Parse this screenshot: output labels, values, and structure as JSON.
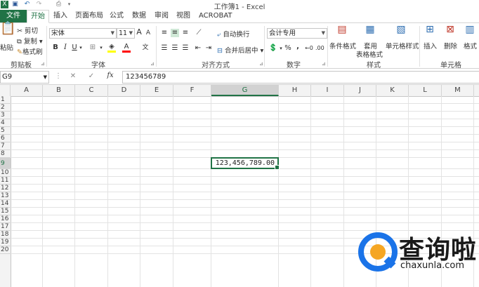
{
  "window": {
    "title": "工作簿1 - Excel"
  },
  "quick_access": {
    "icons": [
      "excel-logo-icon",
      "save-icon",
      "undo-icon",
      "redo-icon",
      "preview-icon",
      "customize-icon"
    ]
  },
  "tabs": [
    {
      "label": "文件"
    },
    {
      "label": "开始"
    },
    {
      "label": "插入"
    },
    {
      "label": "页面布局"
    },
    {
      "label": "公式"
    },
    {
      "label": "数据"
    },
    {
      "label": "审阅"
    },
    {
      "label": "视图"
    },
    {
      "label": "ACROBAT"
    }
  ],
  "ribbon": {
    "clipboard": {
      "paste": "粘贴",
      "cut": "剪切",
      "copy": "复制",
      "format_painter": "格式刷",
      "group": "剪贴板"
    },
    "font": {
      "name": "宋体",
      "size": "11",
      "grow": "A",
      "shrink": "A",
      "bold": "B",
      "italic": "I",
      "underline": "U",
      "color_a": "A",
      "phonetic": "文",
      "group": "字体"
    },
    "alignment": {
      "wrap": "自动换行",
      "merge": "合并后居中",
      "group": "对齐方式"
    },
    "number": {
      "format": "会计专用",
      "percent": "%",
      "comma": ",",
      "group": "数字"
    },
    "styles": {
      "conditional": "条件格式",
      "table_line1": "套用",
      "table_line2": "表格格式",
      "cell_styles": "单元格样式",
      "group": "样式"
    },
    "cells": {
      "insert": "插入",
      "delete": "删除",
      "format": "格式",
      "group": "单元格"
    }
  },
  "formula_bar": {
    "name_box": "G9",
    "cancel": "✕",
    "enter": "✓",
    "fx": "fx",
    "value": "123456789"
  },
  "sheet": {
    "columns": [
      "A",
      "B",
      "C",
      "D",
      "E",
      "F",
      "G",
      "H",
      "I",
      "J",
      "K",
      "L",
      "M"
    ],
    "selected_column": "G",
    "rows": [
      "1",
      "2",
      "3",
      "4",
      "5",
      "6",
      "7",
      "8",
      "9",
      "10",
      "11",
      "12",
      "13",
      "14",
      "15",
      "16",
      "17",
      "18",
      "19",
      "20"
    ],
    "selected_row": "9",
    "active_cell_value": "123,456,789.00"
  },
  "watermark": {
    "brand": "查询啦",
    "url": "chaxunla.com",
    "color": "#1a73e8"
  }
}
